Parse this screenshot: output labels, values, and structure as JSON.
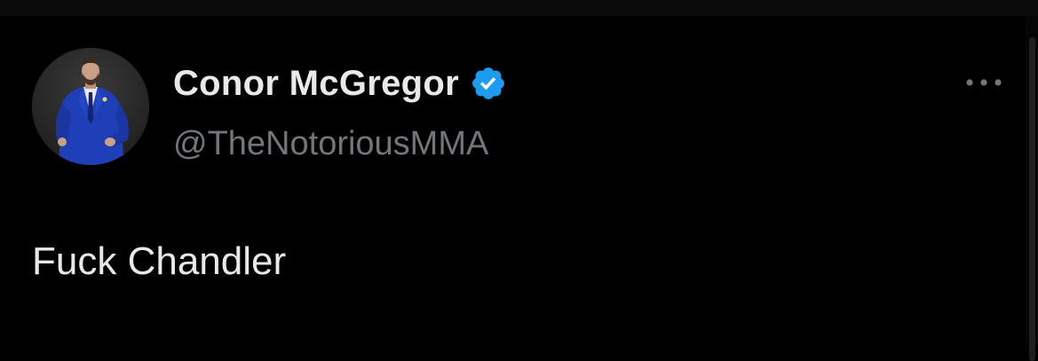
{
  "tweet": {
    "author": {
      "display_name": "Conor McGregor",
      "handle": "@TheNotoriousMMA",
      "verified": true,
      "avatar_icon": "profile-photo",
      "verified_icon": "verified-badge-icon"
    },
    "text": "Fuck Chandler",
    "more_icon": "more-options-icon"
  },
  "colors": {
    "background": "#000000",
    "primary_text": "#e7e9ea",
    "secondary_text": "#71767b",
    "verified_blue": "#1d9bf0",
    "avatar_suit_blue": "#1f3fb8"
  }
}
